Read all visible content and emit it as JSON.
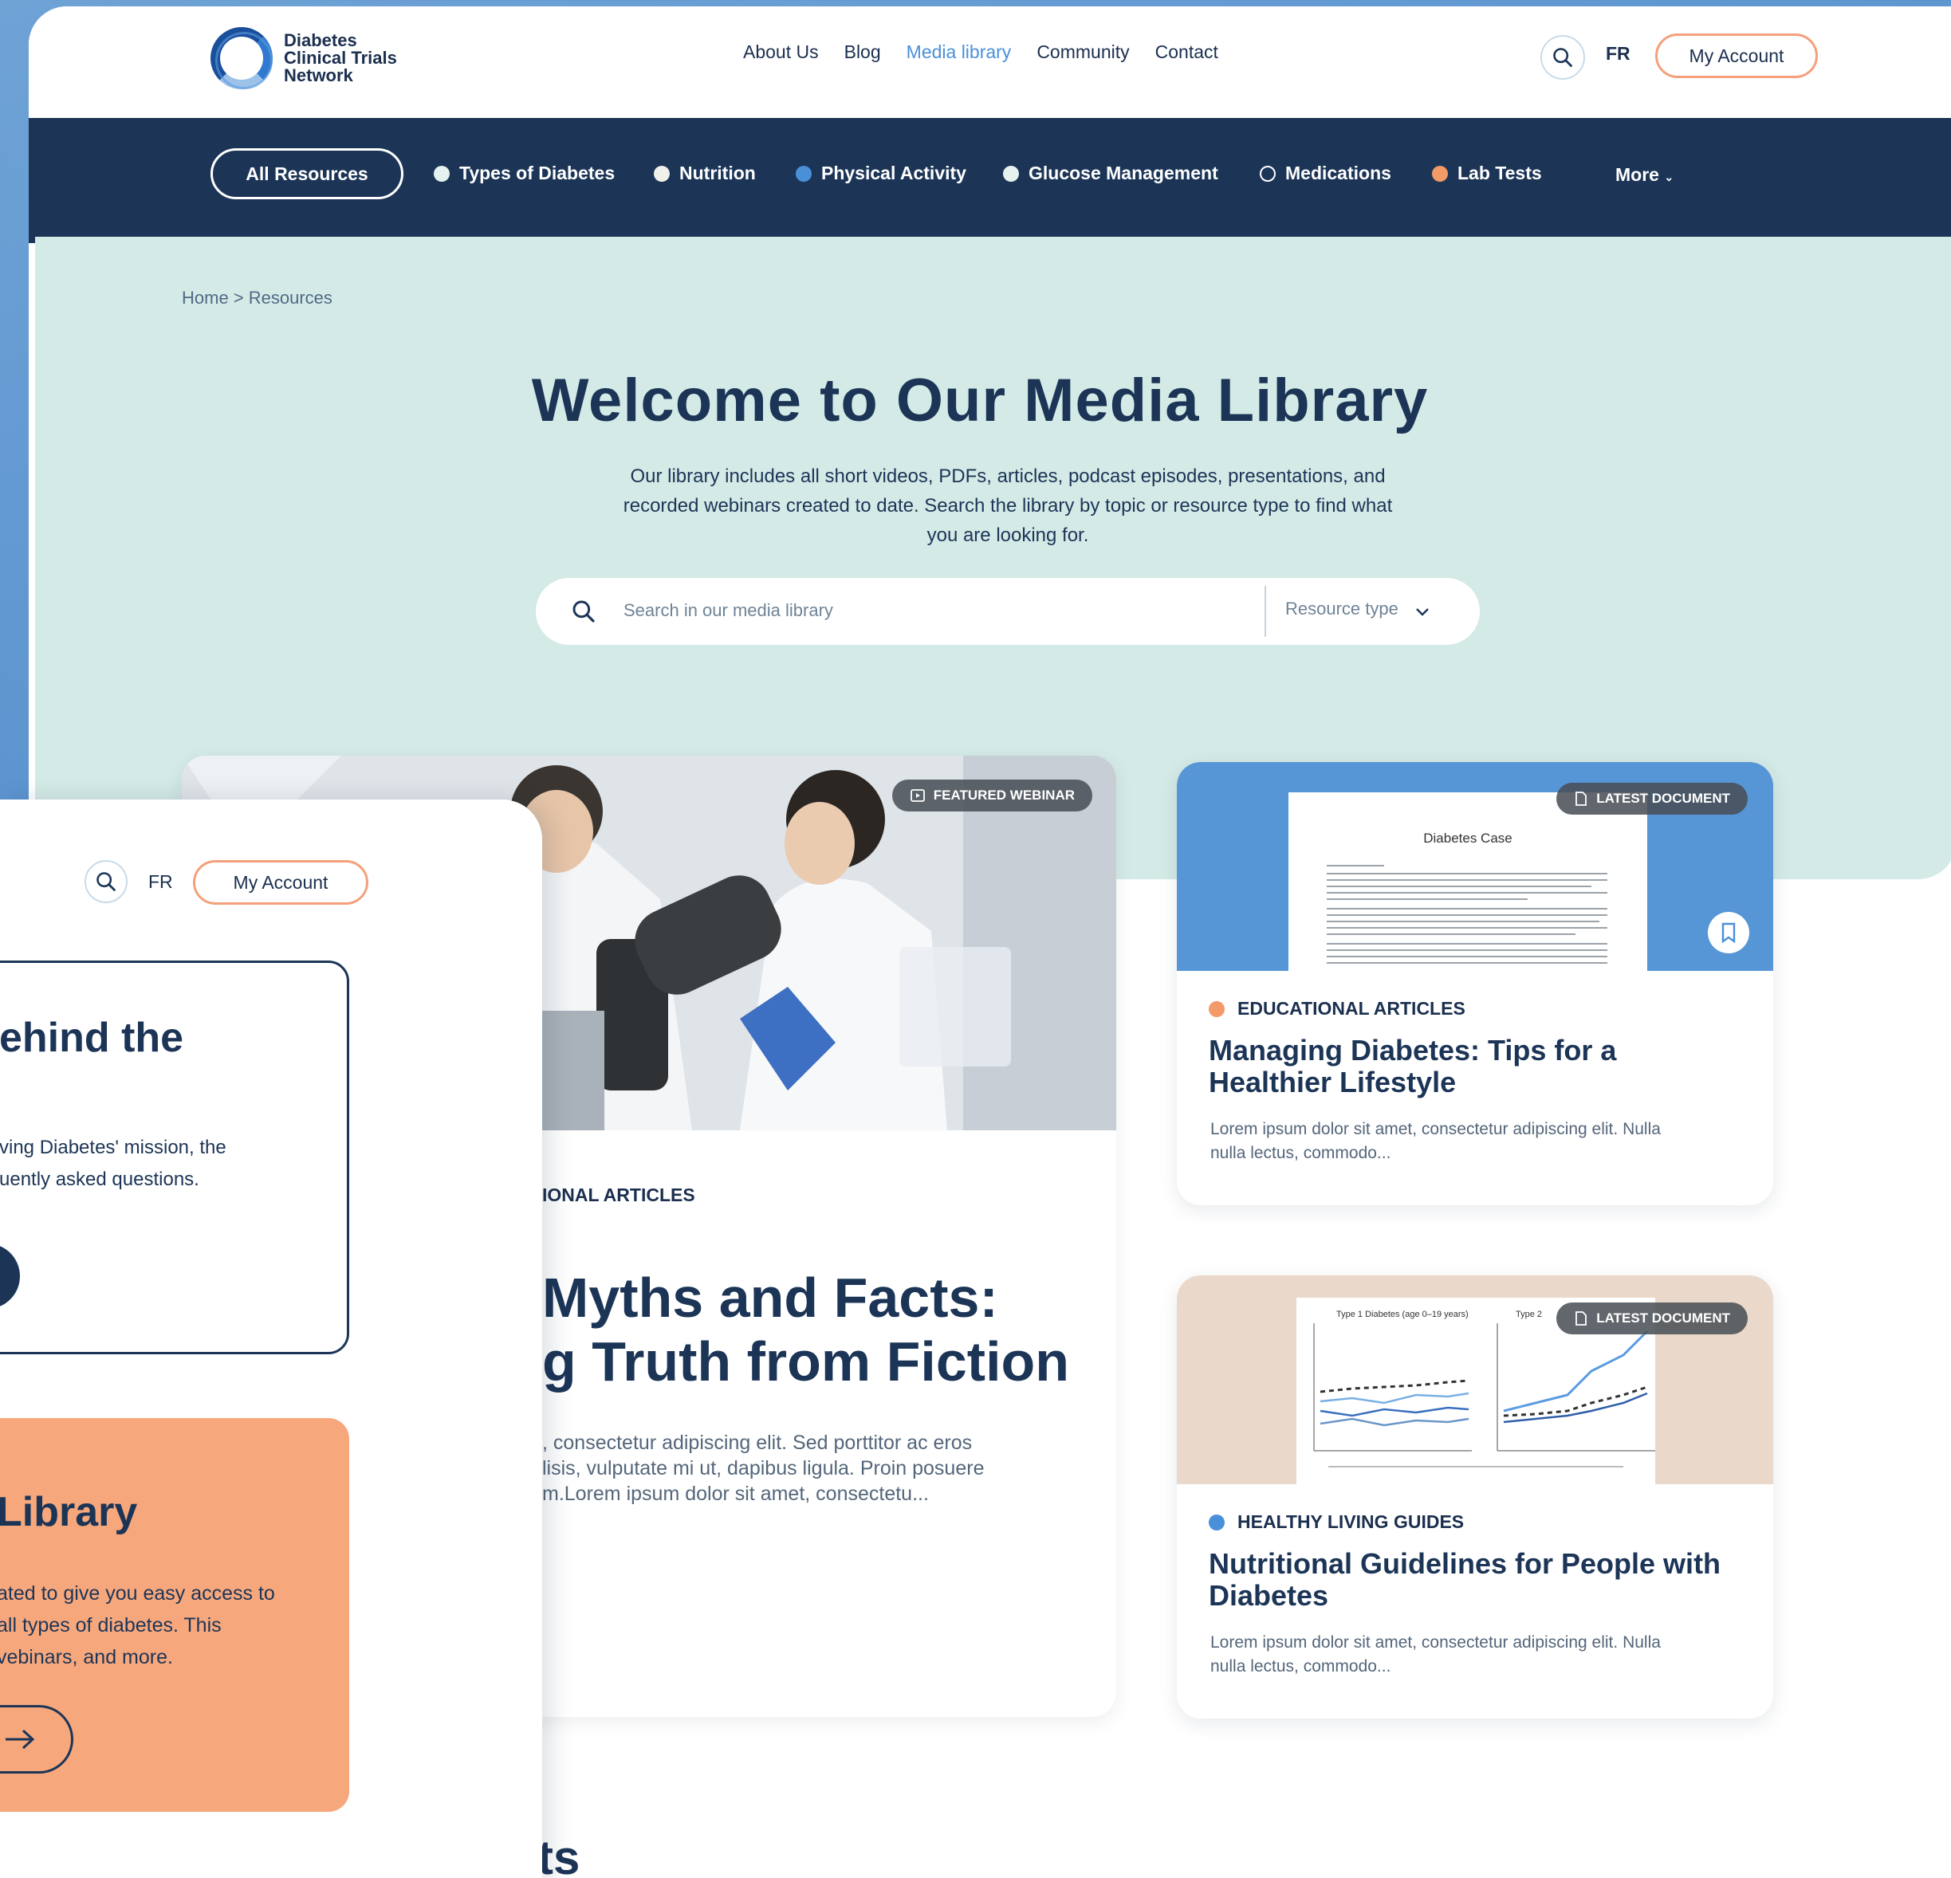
{
  "logo": {
    "line1": "Diabetes",
    "line2": "Clinical Trials",
    "line3": "Network"
  },
  "nav": {
    "items": [
      "About Us",
      "Blog",
      "Media library",
      "Community",
      "Contact"
    ],
    "active_index": 2
  },
  "header": {
    "lang": "FR",
    "account": "My Account"
  },
  "categories": {
    "all": "All Resources",
    "items": [
      {
        "label": "Types of Diabetes",
        "color": "#e6f2ef"
      },
      {
        "label": "Nutrition",
        "color": "#f1f1ec"
      },
      {
        "label": "Physical Activity",
        "color": "#4a90d9"
      },
      {
        "label": "Glucose Management",
        "color": "#e6f2ef"
      },
      {
        "label": "Medications",
        "color": "none"
      },
      {
        "label": "Lab Tests",
        "color": "#f39a69"
      }
    ],
    "more": "More"
  },
  "hero": {
    "breadcrumb": "Home > Resources",
    "title": "Welcome to Our Media Library",
    "subtitle": [
      "Our library includes all short videos, PDFs, articles, podcast episodes, presentations, and",
      "recorded webinars created to date. Search the library by topic or resource type to find what",
      "you are looking for."
    ],
    "search_placeholder": "Search in our media library",
    "resource_type": "Resource type"
  },
  "featured": {
    "badge": "FEATURED WEBINAR",
    "category": "IONAL ARTICLES",
    "title": [
      "Myths and Facts:",
      "g Truth from Fiction"
    ],
    "text": [
      ", consectetur adipiscing elit. Sed porttitor ac eros",
      "lisis, vulputate mi ut, dapibus ligula. Proin posuere",
      "m.Lorem ipsum dolor sit amet, consectetu..."
    ]
  },
  "cards": [
    {
      "badge": "LATEST DOCUMENT",
      "doc_title": "Diabetes Case",
      "category": "EDUCATIONAL ARTICLES",
      "dot": "#f39a69",
      "title": "Managing Diabetes: Tips for a Healthier Lifestyle",
      "text": "Lorem ipsum dolor sit amet, consectetur adipiscing elit. Nulla nulla lectus, commodo..."
    },
    {
      "badge": "LATEST DOCUMENT",
      "chart_label_1": "Type 1 Diabetes (age 0–19 years)",
      "chart_label_2": "Type 2",
      "category": "HEALTHY LIVING GUIDES",
      "dot": "#4a90d9",
      "title": "Nutritional Guidelines for People with Diabetes",
      "text": "Lorem ipsum dolor sit amet, consectetur adipiscing elit. Nulla nulla lectus, commodo..."
    }
  ],
  "overlay": {
    "lang": "FR",
    "account": "My Account",
    "box1_title": "ehind the",
    "box1_text": [
      "ving Diabetes' mission, the",
      "uently asked questions."
    ],
    "box2_title": "Library",
    "box2_text": [
      "ated to give you easy access to",
      "all types of diabetes. This",
      "vebinars, and more."
    ]
  },
  "bottom_fragment": "ts"
}
